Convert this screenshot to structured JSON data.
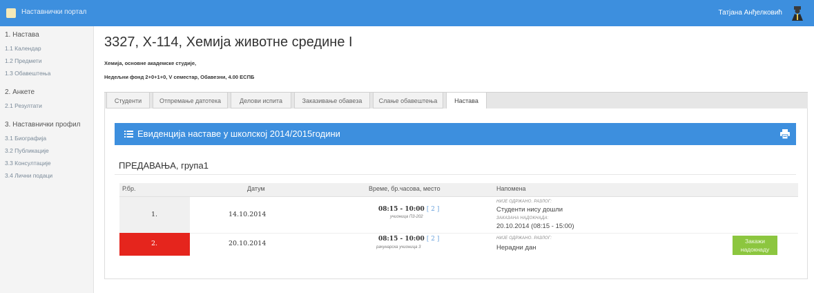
{
  "header": {
    "portal_title": "Наставнички портал",
    "user_name": "Татјана Анђелковић",
    "colors": {
      "accent": "#3d8fde"
    }
  },
  "sidebar": {
    "sections": [
      {
        "label": "1. Настава",
        "items": [
          "1.1 Календар",
          "1.2 Предмети",
          "1.3 Обавештења"
        ]
      },
      {
        "label": "2. Анкете",
        "items": [
          "2.1 Резултати"
        ]
      },
      {
        "label": "3. Наставнички профил",
        "items": [
          "3.1 Биографија",
          "3.2 Публикације",
          "3.3 Консултације",
          "3.4 Лични подаци"
        ]
      }
    ]
  },
  "course": {
    "title": "3327, Х-114, Хемија животне средине I",
    "program": "Хемија, основне академске студије,",
    "details": "Недељни фонд 2+0+1+0, V семестар, Обавезни, 4.00 ЕСПБ"
  },
  "tabs": [
    {
      "label": "Студенти",
      "active": false
    },
    {
      "label": "Отпремање датотека",
      "active": false
    },
    {
      "label": "Делови испита",
      "active": false
    },
    {
      "label": "Заказивање обавеза",
      "active": false
    },
    {
      "label": "Слање обавештења",
      "active": false
    },
    {
      "label": "Настава",
      "active": true
    }
  ],
  "panel": {
    "title": "Евиденција наставе у школској 2014/2015години",
    "group_title": "ПРЕДАВАЊА, група1"
  },
  "table": {
    "headers": [
      "Р.бр.",
      "Датум",
      "Време, бр.часова, место",
      "Напомена"
    ],
    "rows": [
      {
        "num": "1.",
        "date": "14.10.2014",
        "time": "08:15 - 10:00",
        "hours": "[ 2 ]",
        "room": "учионица П3-202",
        "note_label": "НИЈЕ ОДРЖАНО. РАЗЛОГ:",
        "note_reason": "Студенти нису дошли",
        "note_label2": "ЗАКАЗАНА НАДОКНАДА:",
        "note_makeup": "20.10.2014 (08:15 - 15:00)",
        "status_color": "#f0f0f0"
      },
      {
        "num": "2.",
        "date": "20.10.2014",
        "time": "08:15 - 10:00",
        "hours": "[ 2 ]",
        "room": "рачунарска учионица 3",
        "note_label": "НИЈЕ ОДРЖАНО. РАЗЛОГ:",
        "note_reason": "Нерадни дан",
        "status_color": "#e5251d",
        "action_line1": "Закажи",
        "action_line2": "надокнаду"
      }
    ]
  }
}
